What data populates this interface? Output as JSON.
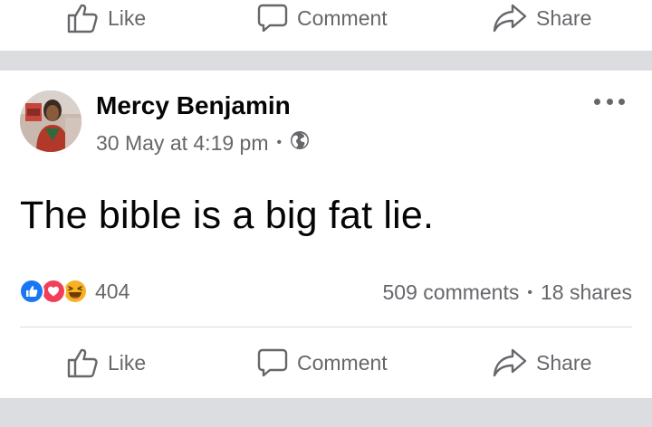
{
  "actions_top": {
    "like_label": "Like",
    "comment_label": "Comment",
    "share_label": "Share"
  },
  "post": {
    "author_name": "Mercy Benjamin",
    "timestamp": "30 May at 4:19 pm",
    "meta_separator": "•",
    "privacy_icon": "globe-icon",
    "text": "The bible is a big fat lie.",
    "reactions": {
      "icons": [
        "like-reaction-icon",
        "love-reaction-icon",
        "haha-reaction-icon"
      ],
      "count": "404"
    },
    "comments": "509 comments",
    "stats_separator": "•",
    "shares": "18 shares"
  },
  "actions_bottom": {
    "like_label": "Like",
    "comment_label": "Comment",
    "share_label": "Share"
  },
  "colors": {
    "text_primary": "#050505",
    "text_secondary": "#65676b",
    "separator": "#dcdde1",
    "like_blue": "#1877f2",
    "love_red": "#f33e58",
    "haha_yellow": "#f7b125"
  }
}
